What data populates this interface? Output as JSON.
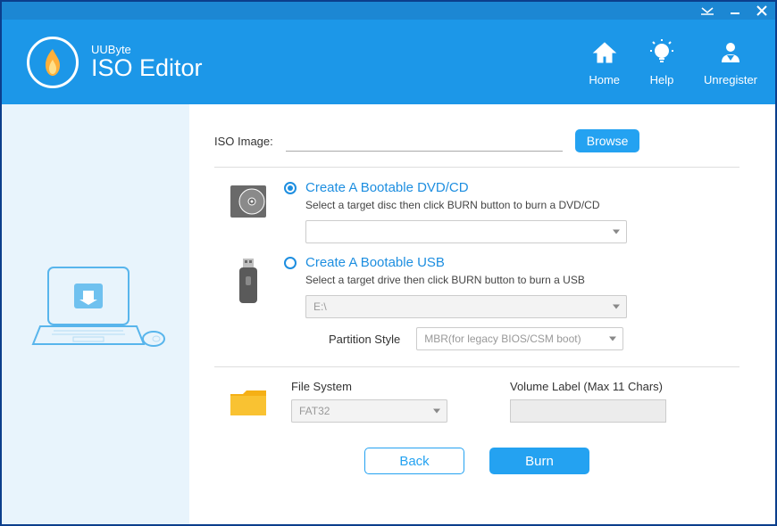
{
  "app": {
    "brand": "UUByte",
    "title": "ISO Editor"
  },
  "nav": {
    "home": "Home",
    "help": "Help",
    "unregister": "Unregister"
  },
  "iso": {
    "label": "ISO Image:",
    "value": "",
    "browse": "Browse"
  },
  "dvd": {
    "title": "Create A Bootable DVD/CD",
    "desc": "Select a target disc then click BURN button to burn a DVD/CD",
    "selected": ""
  },
  "usb": {
    "title": "Create A Bootable USB",
    "desc": "Select a target drive then click BURN button to burn a USB",
    "selected": "E:\\",
    "partition_label": "Partition Style",
    "partition_value": "MBR(for legacy BIOS/CSM boot)"
  },
  "fs": {
    "label": "File System",
    "value": "FAT32",
    "volume_label": "Volume Label (Max 11 Chars)",
    "volume_value": ""
  },
  "actions": {
    "back": "Back",
    "burn": "Burn"
  }
}
